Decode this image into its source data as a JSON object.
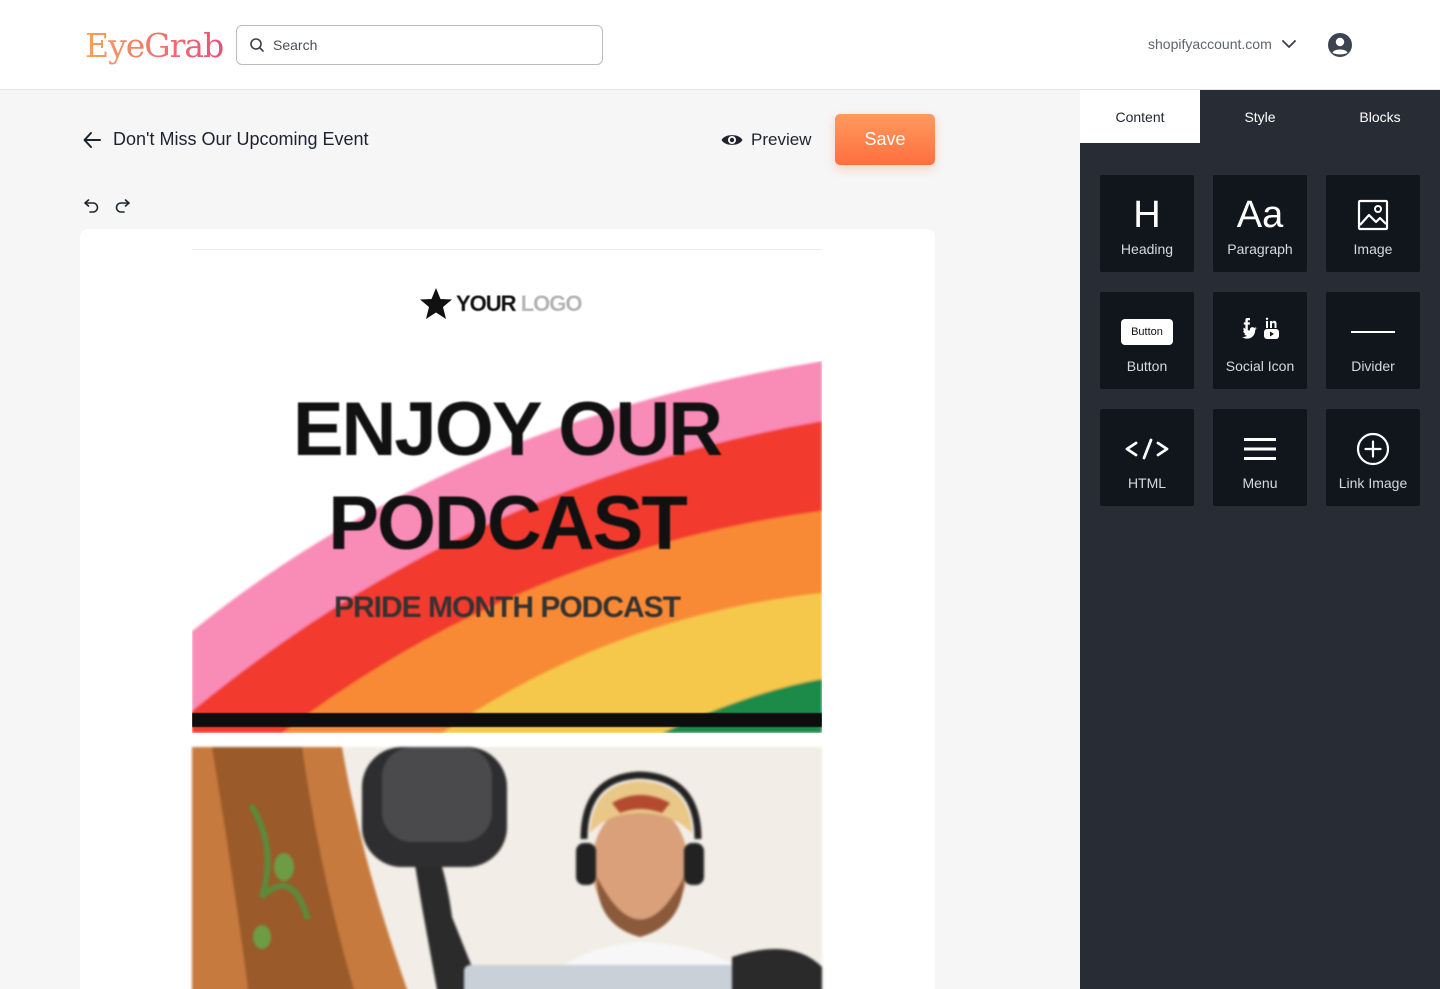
{
  "header": {
    "logo": "EyeGrab",
    "search_placeholder": "Search",
    "account": "shopifyaccount.com"
  },
  "toolbar": {
    "title": "Don't Miss Our Upcoming Event",
    "preview_label": "Preview",
    "save_label": "Save"
  },
  "email": {
    "logo_text_bold": "YOUR",
    "logo_text_light": "LOGO",
    "hero_title_line1": "ENJOY OUR",
    "hero_title_line2": "PODCAST",
    "hero_subtitle": "PRIDE MONTH PODCAST"
  },
  "panel": {
    "tabs": [
      "Content",
      "Style",
      "Blocks"
    ],
    "active_tab": "Content",
    "tiles": [
      {
        "label": "Heading",
        "glyph": "H"
      },
      {
        "label": "Paragraph",
        "glyph": "Aa"
      },
      {
        "label": "Image",
        "icon": "image-icon"
      },
      {
        "label": "Button",
        "mini": "Button"
      },
      {
        "label": "Social Icon",
        "icon": "social-icons"
      },
      {
        "label": "Divider",
        "icon": "divider-icon"
      },
      {
        "label": "HTML",
        "icon": "code-icon"
      },
      {
        "label": "Menu",
        "icon": "menu-icon"
      },
      {
        "label": "Link Image",
        "icon": "plus-circle-icon"
      }
    ]
  },
  "colors": {
    "accent": "#ff7a45",
    "panel_bg": "#282d35",
    "tile_bg": "#11151c"
  }
}
